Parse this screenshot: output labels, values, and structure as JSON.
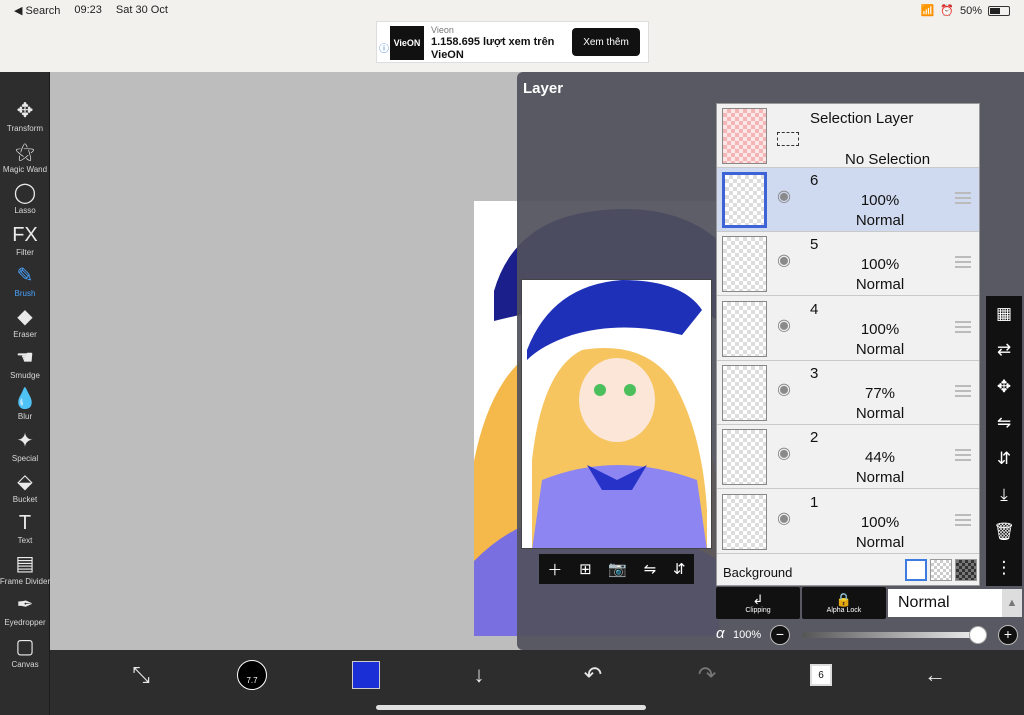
{
  "status": {
    "back": "◀ Search",
    "time": "09:23",
    "date": "Sat 30 Oct",
    "battery": "50%"
  },
  "ad": {
    "brand": "Vieon",
    "logo": "VieON",
    "text": "1.158.695 lượt xem trên VieON",
    "cta": "Xem thêm"
  },
  "tools": [
    {
      "label": "Transform",
      "icon": "✥",
      "active": false
    },
    {
      "label": "Magic Wand",
      "icon": "⚝",
      "active": false
    },
    {
      "label": "Lasso",
      "icon": "◯",
      "active": false
    },
    {
      "label": "Filter",
      "icon": "FX",
      "active": false
    },
    {
      "label": "Brush",
      "icon": "✎",
      "active": true
    },
    {
      "label": "Eraser",
      "icon": "◆",
      "active": false
    },
    {
      "label": "Smudge",
      "icon": "☚",
      "active": false
    },
    {
      "label": "Blur",
      "icon": "💧",
      "active": false
    },
    {
      "label": "Special",
      "icon": "✦",
      "active": false
    },
    {
      "label": "Bucket",
      "icon": "⬙",
      "active": false
    },
    {
      "label": "Text",
      "icon": "T",
      "active": false
    },
    {
      "label": "Frame Divider",
      "icon": "▤",
      "active": false
    },
    {
      "label": "Eyedropper",
      "icon": "✒",
      "active": false
    },
    {
      "label": "Canvas",
      "icon": "▢",
      "active": false
    }
  ],
  "panel": {
    "title": "Layer"
  },
  "selection_layer": {
    "title": "Selection Layer",
    "subtitle": "No Selection"
  },
  "layers": [
    {
      "num": "6",
      "opacity": "100%",
      "mode": "Normal",
      "selected": true
    },
    {
      "num": "5",
      "opacity": "100%",
      "mode": "Normal",
      "selected": false
    },
    {
      "num": "4",
      "opacity": "100%",
      "mode": "Normal",
      "selected": false
    },
    {
      "num": "3",
      "opacity": "77%",
      "mode": "Normal",
      "selected": false
    },
    {
      "num": "2",
      "opacity": "44%",
      "mode": "Normal",
      "selected": false
    },
    {
      "num": "1",
      "opacity": "100%",
      "mode": "Normal",
      "selected": false
    }
  ],
  "background": {
    "label": "Background"
  },
  "buttons": {
    "clipping": "Clipping",
    "alpha_lock": "Alpha Lock"
  },
  "blend_mode": "Normal",
  "alpha": {
    "symbol": "α",
    "value": "100%",
    "level": 1.0
  },
  "bottom": {
    "brush_size": "7.7",
    "layer_count": "6"
  },
  "colors": {
    "current": "#1b2fd6",
    "accent": "#4aa3ff",
    "selected_row": "#cfd9ef"
  }
}
